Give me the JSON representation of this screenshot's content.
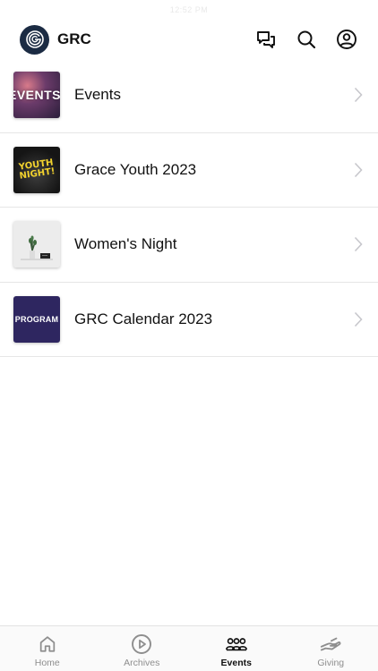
{
  "statusbar": {
    "text": "12:52 PM"
  },
  "header": {
    "app_name": "GRC",
    "actions": [
      {
        "icon": "chat-icon"
      },
      {
        "icon": "search-icon"
      },
      {
        "icon": "account-icon"
      }
    ]
  },
  "events": {
    "items": [
      {
        "label": "Events",
        "thumb_text": "EVENTS"
      },
      {
        "label": "Grace Youth 2023",
        "thumb_text": "YOUTH NIGHT!"
      },
      {
        "label": "Women's Night"
      },
      {
        "label": "GRC Calendar 2023",
        "thumb_text": "PROGRAM"
      }
    ]
  },
  "tabbar": {
    "tabs": [
      {
        "label": "Home",
        "icon": "home-icon"
      },
      {
        "label": "Archives",
        "icon": "play-icon"
      },
      {
        "label": "Events",
        "icon": "people-icon",
        "active": true
      },
      {
        "label": "Giving",
        "icon": "giving-hand-icon"
      }
    ]
  },
  "colors": {
    "brand_logo_bg": "#1b2b43",
    "active_tab": "#111111",
    "inactive_tab": "#8e8e8e",
    "program_thumb_bg": "#2e2660",
    "youth_text": "#f2d22e"
  }
}
